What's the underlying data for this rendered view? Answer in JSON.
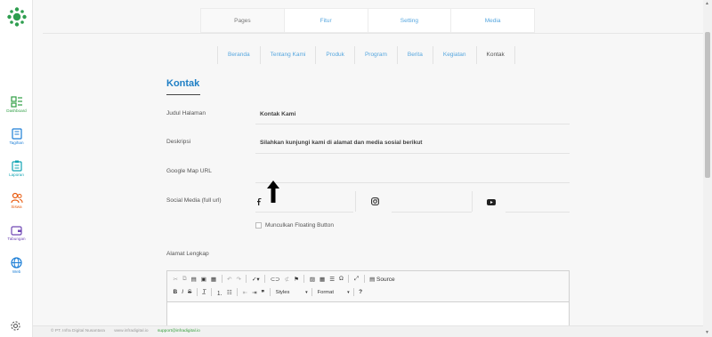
{
  "sidebar": {
    "items": [
      {
        "label": "Dashboard",
        "icon": "dashboard-icon",
        "color": "#2f9e44"
      },
      {
        "label": "Tagihan",
        "icon": "book-icon",
        "color": "#1c7ed6"
      },
      {
        "label": "Laporan",
        "icon": "clipboard-icon",
        "color": "#12a4b3"
      },
      {
        "label": "Siswa",
        "icon": "users-icon",
        "color": "#e8590c"
      },
      {
        "label": "Tabungan",
        "icon": "wallet-icon",
        "color": "#7048b5"
      },
      {
        "label": "Web",
        "icon": "globe-icon",
        "color": "#1c7ed6"
      }
    ]
  },
  "tabs": [
    "Pages",
    "Fitur",
    "Setting",
    "Media"
  ],
  "active_tab": "Pages",
  "subtabs": [
    "Beranda",
    "Tentang Kami",
    "Produk",
    "Program",
    "Berita",
    "Kegiatan",
    "Kontak"
  ],
  "active_subtab": "Kontak",
  "form": {
    "title": "Kontak",
    "fields": {
      "judul_label": "Judul Halaman",
      "judul_value": "Kontak Kami",
      "deskripsi_label": "Deskripsi",
      "deskripsi_value": "Silahkan kunjungi kami di alamat dan media sosial berikut",
      "map_label": "Google Map URL",
      "social_label": "Social Media (full url)",
      "floating_label": "Munculkan Floating Button",
      "alamat_label": "Alamat Lengkap"
    }
  },
  "editor": {
    "source_label": "Source",
    "styles_label": "Styles",
    "format_label": "Format"
  },
  "footer": {
    "company": "© PT. Infra Digital Nusantara",
    "website": "www.infradigital.io",
    "email": "support@infradigital.io"
  },
  "colors": {
    "accent": "#1f7fc5",
    "link": "#57a7df",
    "logo": "#2e9e4f"
  }
}
